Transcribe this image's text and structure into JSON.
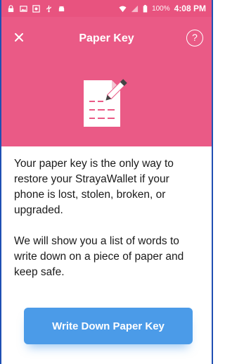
{
  "status_bar": {
    "battery": "100%",
    "time": "4:08 PM",
    "icons": [
      "lock-icon",
      "image-icon",
      "screenshot-icon",
      "usb-icon",
      "android-icon",
      "wifi-icon",
      "signal-icon",
      "battery-icon"
    ]
  },
  "header": {
    "title": "Paper Key",
    "close_icon": "close-icon",
    "help_label": "?",
    "illustration": "paper-pencil-icon",
    "bg_color": "#ea5a86"
  },
  "body": {
    "paragraph1": "Your paper key is the only way to restore your StrayaWallet if your phone is lost, stolen, broken, or upgraded.",
    "paragraph2": "We will show you a list of words to write down on a piece of paper and keep safe."
  },
  "action": {
    "button_label": "Write Down Paper Key",
    "button_color": "#4b9be8"
  }
}
